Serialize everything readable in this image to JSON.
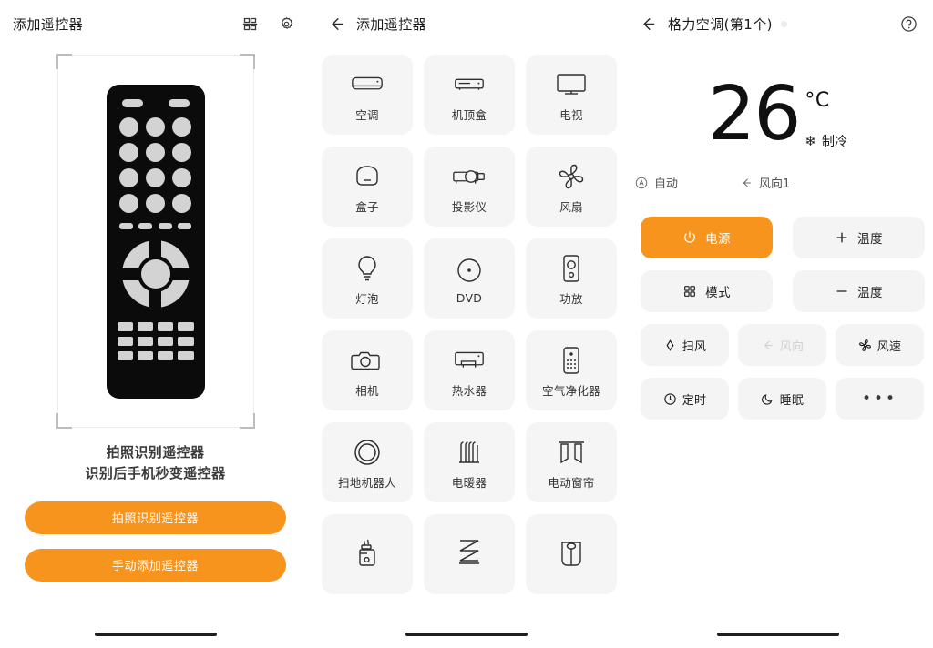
{
  "panel_add": {
    "title": "添加遥控器",
    "split_icon": "split-screen-icon",
    "gear_icon": "gear-icon",
    "scan_hint_line1": "拍照识别遥控器",
    "scan_hint_line2": "识别后手机秒变遥控器",
    "cta_primary": "拍照识别遥控器",
    "cta_secondary": "手动添加遥控器",
    "accent_color": "#F7941E",
    "remote_body_color": "#0b0b0b",
    "remote_key_color": "#d3d3d3"
  },
  "panel_types": {
    "title": "添加遥控器",
    "back_icon": "back-arrow-icon",
    "devices": [
      {
        "label": "空调",
        "icon": "air-conditioner-icon"
      },
      {
        "label": "机顶盒",
        "icon": "set-top-box-icon"
      },
      {
        "label": "电视",
        "icon": "tv-icon"
      },
      {
        "label": "盒子",
        "icon": "tv-box-icon"
      },
      {
        "label": "投影仪",
        "icon": "projector-icon"
      },
      {
        "label": "风扇",
        "icon": "fan-icon"
      },
      {
        "label": "灯泡",
        "icon": "light-bulb-icon"
      },
      {
        "label": "DVD",
        "icon": "dvd-disc-icon"
      },
      {
        "label": "功放",
        "icon": "amplifier-icon"
      },
      {
        "label": "相机",
        "icon": "camera-icon"
      },
      {
        "label": "热水器",
        "icon": "water-heater-icon"
      },
      {
        "label": "空气净化器",
        "icon": "air-purifier-icon"
      },
      {
        "label": "扫地机器人",
        "icon": "robot-vacuum-icon"
      },
      {
        "label": "电暖器",
        "icon": "radiator-heater-icon"
      },
      {
        "label": "电动窗帘",
        "icon": "electric-curtain-icon"
      },
      {
        "label": "",
        "icon": "humidifier-icon"
      },
      {
        "label": "",
        "icon": "air-circulator-icon"
      },
      {
        "label": "",
        "icon": "rice-cooker-icon"
      }
    ],
    "tile_bg": "#f5f5f5"
  },
  "panel_control": {
    "title": "格力空调(第1个)",
    "back_icon": "back-arrow-icon",
    "help_icon": "help-circle-icon",
    "temperature": "26",
    "unit": "°C",
    "mode_label": "制冷",
    "mode_icon": "snowflake-icon",
    "status": [
      {
        "label": "自动",
        "icon": "auto-mode-icon"
      },
      {
        "label": "风向1",
        "icon": "wind-direction-icon"
      }
    ],
    "main_buttons": [
      {
        "label": "电源",
        "icon": "power-icon",
        "primary": true
      },
      {
        "label": "温度",
        "icon": "plus-icon",
        "primary": false
      },
      {
        "label": "模式",
        "icon": "mode-grid-icon",
        "primary": false
      },
      {
        "label": "温度",
        "icon": "minus-icon",
        "primary": false
      }
    ],
    "small_buttons": [
      {
        "label": "扫风",
        "icon": "swing-icon",
        "disabled": false
      },
      {
        "label": "风向",
        "icon": "wind-direction-icon",
        "disabled": true
      },
      {
        "label": "风速",
        "icon": "fan-speed-icon",
        "disabled": false
      },
      {
        "label": "定时",
        "icon": "timer-clock-icon",
        "disabled": false
      },
      {
        "label": "睡眠",
        "icon": "moon-sleep-icon",
        "disabled": false
      },
      {
        "label": "•••",
        "icon": "more-dots-icon",
        "disabled": false
      }
    ],
    "accent_color": "#F7941E",
    "button_bg": "#f4f4f4"
  }
}
